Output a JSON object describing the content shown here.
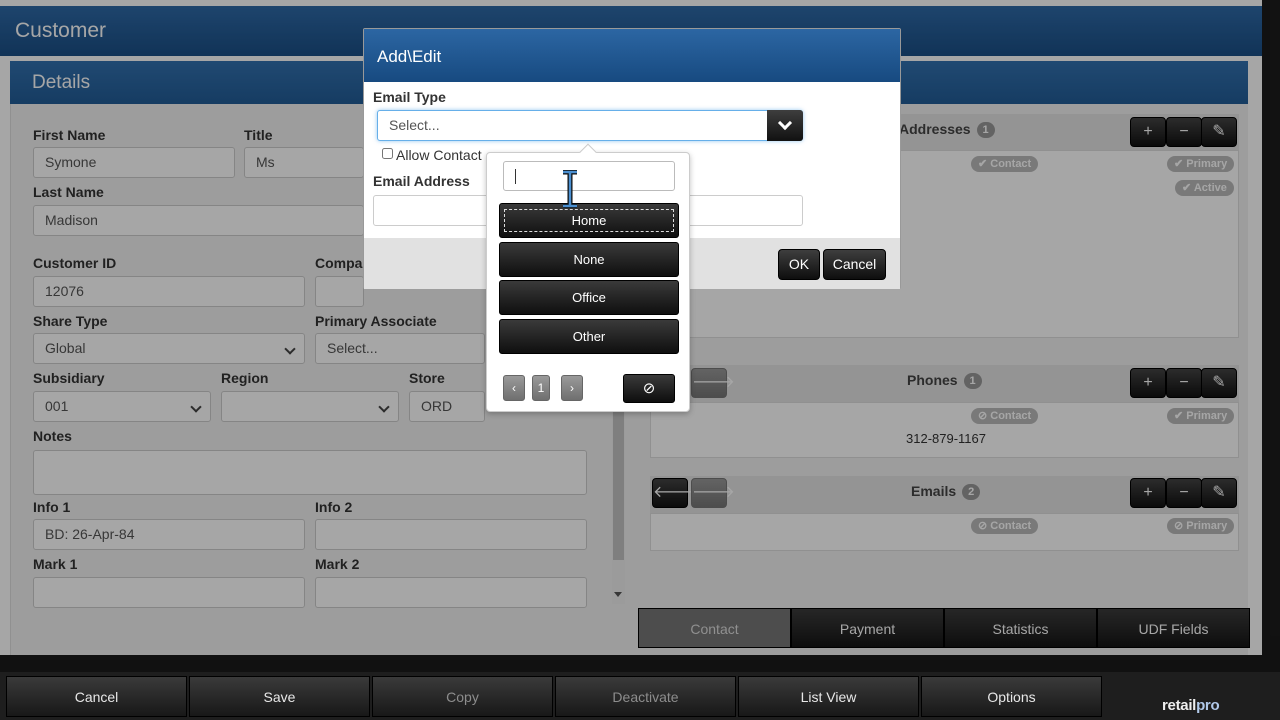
{
  "page": {
    "title": "Customer",
    "section": "Details"
  },
  "form": {
    "first_name": {
      "label": "First Name",
      "value": "Symone"
    },
    "title": {
      "label": "Title",
      "value": "Ms"
    },
    "last_name": {
      "label": "Last Name",
      "value": "Madison"
    },
    "customer_id": {
      "label": "Customer ID",
      "value": "12076"
    },
    "company": {
      "label": "Compan",
      "value": ""
    },
    "share_type": {
      "label": "Share Type",
      "value": "Global"
    },
    "primary_associate": {
      "label": "Primary Associate",
      "value": "Select..."
    },
    "subsidiary": {
      "label": "Subsidiary",
      "value": "001"
    },
    "region": {
      "label": "Region",
      "value": ""
    },
    "store": {
      "label": "Store",
      "value": "ORD"
    },
    "notes": {
      "label": "Notes",
      "value": ""
    },
    "info1": {
      "label": "Info 1",
      "value": "BD: 26-Apr-84"
    },
    "info2": {
      "label": "Info 2",
      "value": ""
    },
    "mark1": {
      "label": "Mark 1",
      "value": ""
    },
    "mark2": {
      "label": "Mark 2",
      "value": ""
    }
  },
  "addresses": {
    "title": "Addresses",
    "count": "1",
    "badges": {
      "contact": "✔ Contact",
      "primary": "✔ Primary",
      "active": "✔ Active"
    }
  },
  "phones": {
    "title": "Phones",
    "count": "1",
    "badges": {
      "contact": "⊘ Contact",
      "primary": "✔ Primary"
    },
    "number": "312-879-1167"
  },
  "emails": {
    "title": "Emails",
    "count": "2",
    "badges": {
      "contact": "⊘ Contact",
      "primary": "⊘ Primary"
    }
  },
  "card_buttons": {
    "add": "+",
    "remove": "−",
    "edit": "✎",
    "prev": "🡐",
    "next": "🡒"
  },
  "tabs": [
    {
      "label": "Contact"
    },
    {
      "label": "Payment"
    },
    {
      "label": "Statistics"
    },
    {
      "label": "UDF Fields"
    }
  ],
  "footer": {
    "buttons": [
      {
        "label": "Cancel"
      },
      {
        "label": "Save"
      },
      {
        "label": "Copy"
      },
      {
        "label": "Deactivate"
      },
      {
        "label": "List View"
      },
      {
        "label": "Options"
      }
    ],
    "logo": {
      "main": "retail",
      "accent": "pro"
    }
  },
  "dialog": {
    "title": "Add\\Edit",
    "email_type_label": "Email Type",
    "email_type_placeholder": "Select...",
    "allow_contact_label": "Allow Contact",
    "email_address_label": "Email Address",
    "email_address_value": "",
    "ok_label": "OK",
    "cancel_label": "Cancel"
  },
  "dropdown": {
    "search_value": "",
    "options": [
      "Home",
      "None",
      "Office",
      "Other"
    ],
    "focused_option": "Home",
    "page": "1",
    "prev_icon": "‹",
    "next_icon": "›",
    "clear_icon": "⊘"
  },
  "colors": {
    "header_blue": "#1b4f86",
    "dark_button": "#111111",
    "focus_border": "#66afe9"
  }
}
